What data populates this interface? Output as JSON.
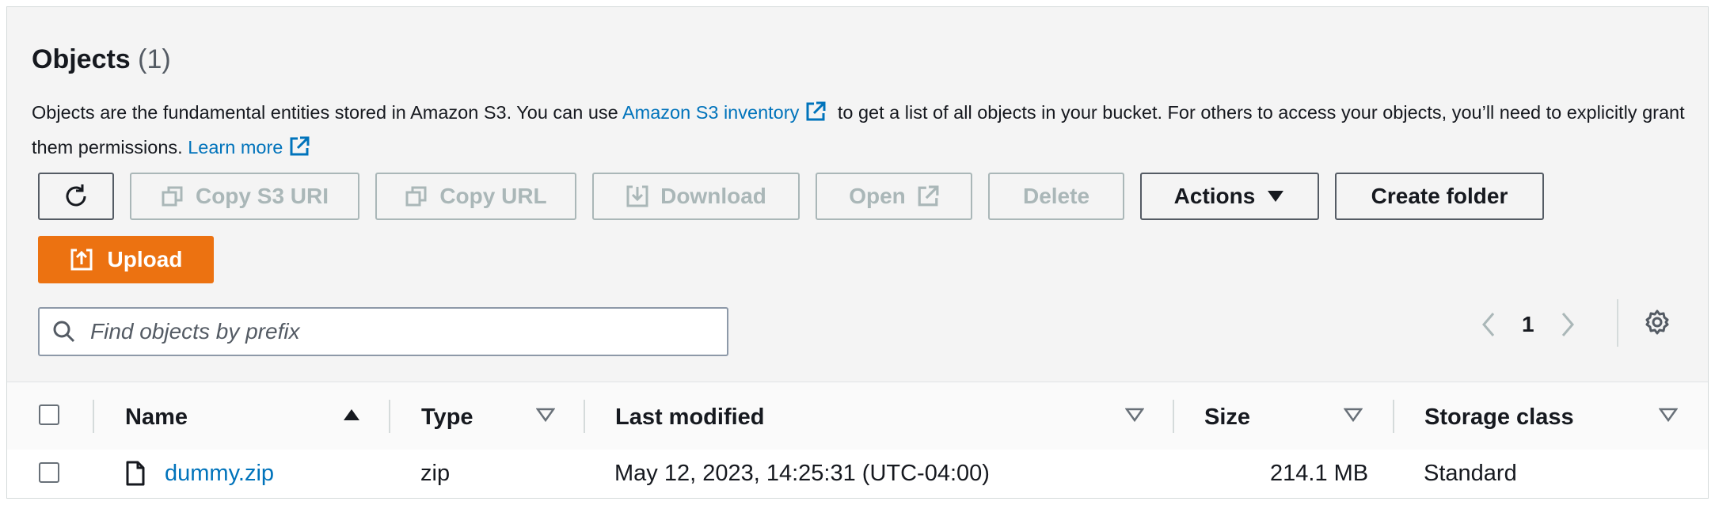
{
  "header": {
    "title": "Objects",
    "count": "(1)",
    "desc_part1": "Objects are the fundamental entities stored in Amazon S3. You can use ",
    "inventory_link": "Amazon S3 inventory",
    "desc_part2": " to get a list of all objects in your bucket. For others to access your objects, you’ll need to explicitly grant them permissions. ",
    "learn_more": "Learn more"
  },
  "toolbar": {
    "copy_s3_uri": "Copy S3 URI",
    "copy_url": "Copy URL",
    "download": "Download",
    "open": "Open",
    "delete": "Delete",
    "actions": "Actions",
    "create_folder": "Create folder",
    "upload": "Upload"
  },
  "search": {
    "placeholder": "Find objects by prefix"
  },
  "pagination": {
    "current_page": "1"
  },
  "table": {
    "columns": {
      "name": "Name",
      "type": "Type",
      "last_modified": "Last modified",
      "size": "Size",
      "storage_class": "Storage class"
    },
    "rows": [
      {
        "name": "dummy.zip",
        "type": "zip",
        "last_modified": "May 12, 2023, 14:25:31 (UTC-04:00)",
        "size": "214.1 MB",
        "storage_class": "Standard"
      }
    ]
  },
  "colors": {
    "link": "#0073bb",
    "upload_bg": "#ec7211",
    "disabled": "#aab7b8"
  },
  "icons": [
    "refresh-icon",
    "copy-icon",
    "download-icon",
    "external-link-icon",
    "caret-down-icon",
    "upload-icon",
    "search-icon",
    "chevron-left-icon",
    "chevron-right-icon",
    "settings-icon",
    "sort-ascending-icon",
    "sort-descending-icon",
    "file-icon"
  ]
}
